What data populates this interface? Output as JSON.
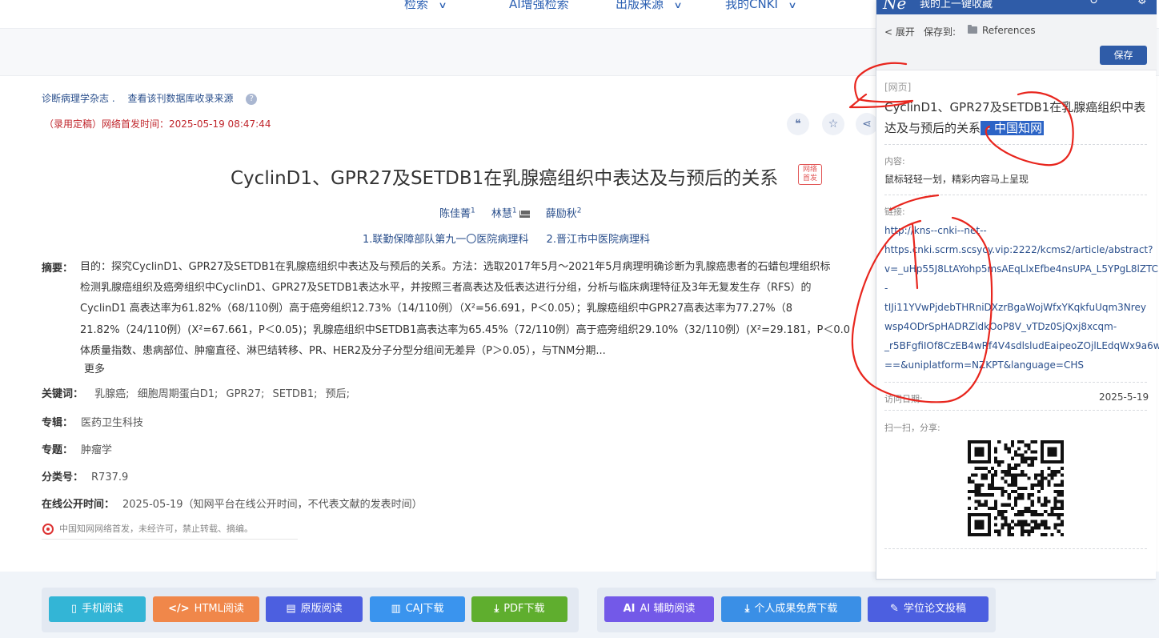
{
  "nav": {
    "items": [
      {
        "label": "检索",
        "chevron": true
      },
      {
        "label": "AI增强检索",
        "chevron": false
      },
      {
        "label": "出版来源",
        "chevron": true
      },
      {
        "label": "我的CNKI",
        "chevron": true
      }
    ]
  },
  "article": {
    "journal": "诊断病理学杂志 .",
    "db_source": "查看该刊数据库收录来源",
    "pub_notice": "（录用定稿）网络首发时间：2025-05-19 08:47:44",
    "title": "CyclinD1、GPR27及SETDB1在乳腺癌组织中表达及与预后的关系",
    "first_badge_line1": "网络",
    "first_badge_line2": "首发",
    "authors": [
      {
        "name": "陈佳菁",
        "sup": "1"
      },
      {
        "name": "林慧",
        "sup": "1"
      },
      {
        "name": "薛励秋",
        "sup": "2"
      }
    ],
    "affiliations": [
      "1.联勤保障部队第九一〇医院病理科",
      "2.晋江市中医院病理科"
    ],
    "abstract_label": "摘要：",
    "abstract_lines": [
      "目的：探究CyclinD1、GPR27及SETDB1在乳腺癌组织中表达及与预后的关系。方法：选取2017年5月～2021年5月病理明确诊断为乳腺癌患者的石蜡包埋组织标",
      "检测乳腺癌组织及癌旁组织中CyclinD1、GPR27及SETDB1表达水平，并按照三者高表达及低表达进行分组，分析与临床病理特征及3年无复发生存（RFS）的",
      "CyclinD1 高表达率为61.82%（68/110例）高于癌旁组织12.73%（14/110例）（X²=56.691，P＜0.05）；乳腺癌组织中GPR27高表达率为77.27%（8",
      "21.82%（24/110例）(X²=67.661，P＜0.05)；乳腺癌组织中SETDB1高表达率为65.45%（72/110例）高于癌旁组织29.10%（32/110例）(X²=29.181，P＜0.0",
      "体质量指数、患病部位、肿瘤直径、淋巴结转移、PR、HER2及分子分型分组间无差异（P＞0.05），与TNM分期..."
    ],
    "more": "更多",
    "keywords_label": "关键词：",
    "keywords": [
      "乳腺癌;",
      "细胞周期蛋白D1;",
      "GPR27;",
      "SETDB1;",
      "预后;"
    ],
    "album_label": "专辑：",
    "album": "医药卫生科技",
    "topic_label": "专题：",
    "topic": "肿瘤学",
    "class_label": "分类号：",
    "class_no": "R737.9",
    "online_label": "在线公开时间：",
    "online": "2025-05-19（知网平台在线公开时间，不代表文献的发表时间）",
    "copyright": "中国知网网络首发，未经许可，禁止转载、摘编。"
  },
  "buttons": [
    {
      "label": "手机阅读",
      "icon": "▯",
      "color": "#33b5d6"
    },
    {
      "label": "HTML阅读",
      "icon": "</>",
      "color": "#f0874a"
    },
    {
      "label": "原版阅读",
      "icon": "▤",
      "color": "#4c5fe0"
    },
    {
      "label": "CAJ下载",
      "icon": "▥",
      "color": "#3a94ee"
    },
    {
      "label": "PDF下载",
      "icon": "⤓",
      "color": "#5fae2e"
    },
    {
      "label": "AI 辅助阅读",
      "icon": "AI",
      "color": "#7359e8"
    },
    {
      "label": "个人成果免费下载",
      "icon": "⤓",
      "color": "#3a8fe6"
    },
    {
      "label": "学位论文投稿",
      "icon": "✎",
      "color": "#4c5fe0"
    }
  ],
  "panel": {
    "logo": "Ne",
    "title": "我的上一键收藏",
    "expand": "< 展开",
    "save_to": "保存到:",
    "folder": "References",
    "save_button": "保存",
    "type": "[网页]",
    "title_main": "CyclinD1、GPR27及SETDB1在乳腺癌组织中表达及与预后的关系",
    "title_suffix": " - 中国知网",
    "content_label": "内容:",
    "content": "鼠标轻轻一划，精彩内容马上呈现",
    "link_label": "链接:",
    "link_lines": [
      "http://kns--cnki--net--",
      "https.cnki.scrm.scsycy.vip:2222/kcms2/article/abstract?",
      "v=_uHp55J8LtAYohp5msAEqLlxEfbe4nsUPA_L5YPgL8lZTC",
      "-",
      "tIJi11YVwPjdebTHRniDXzrBgaWojWfxYKqkfuUqm3Nrey",
      "wsp4ODrSpHADRZldkOoP8V_vTDz0SjQxj8xcqm-",
      "_r5BFgfiIOf8CzEB4wRf4V4sdlsludEaipeoZOjlLEdqWx9a6w",
      "==&uniplatform=NZKPT&language=CHS"
    ],
    "visit_label": "访问日期:",
    "visit_date": "2025-5-19",
    "share_label": "扫一扫，分享:"
  },
  "colors": {
    "accent": "#2f5ca8",
    "link": "#2a4f8c",
    "alert": "#c0262c",
    "annotation": "#e8261e"
  }
}
